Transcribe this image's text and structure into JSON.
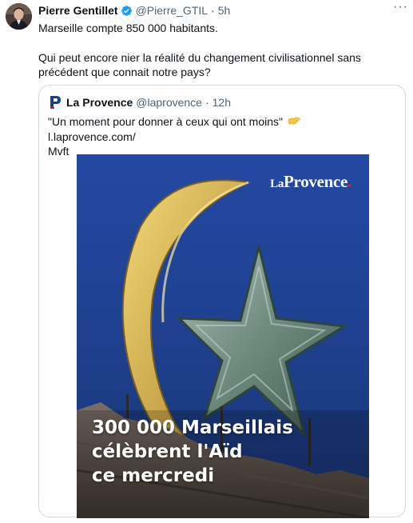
{
  "tweet": {
    "author_name": "Pierre Gentillet",
    "handle": "@Pierre_GTIL",
    "time": "5h",
    "more_icon": "more-horizontal-icon",
    "text_line1": "Marseille compte 850 000 habitants.",
    "text_line2": "Qui peut encore nier la réalité du changement civilisationnel sans précédent que connait notre pays?",
    "verified_color": "#1d9bf0"
  },
  "quote": {
    "author_name": "La Provence",
    "handle": "@laprovence",
    "time": "12h",
    "text_before": "\"Un moment pour donner à ceux qui ont moins\"",
    "link": "l.laprovence.com/Mvft",
    "link_part1": "l.laprovence.com/",
    "link_part2": "Mvft",
    "pointer_icon": "backhand-index-pointing-right-icon",
    "media": {
      "brand_la": "La",
      "brand_main": "Provence",
      "brand_dot": ".",
      "headline_line1": "300 000 Marseillais",
      "headline_line2": "célèbrent l'Aïd",
      "headline_line3": "ce mercredi"
    }
  }
}
